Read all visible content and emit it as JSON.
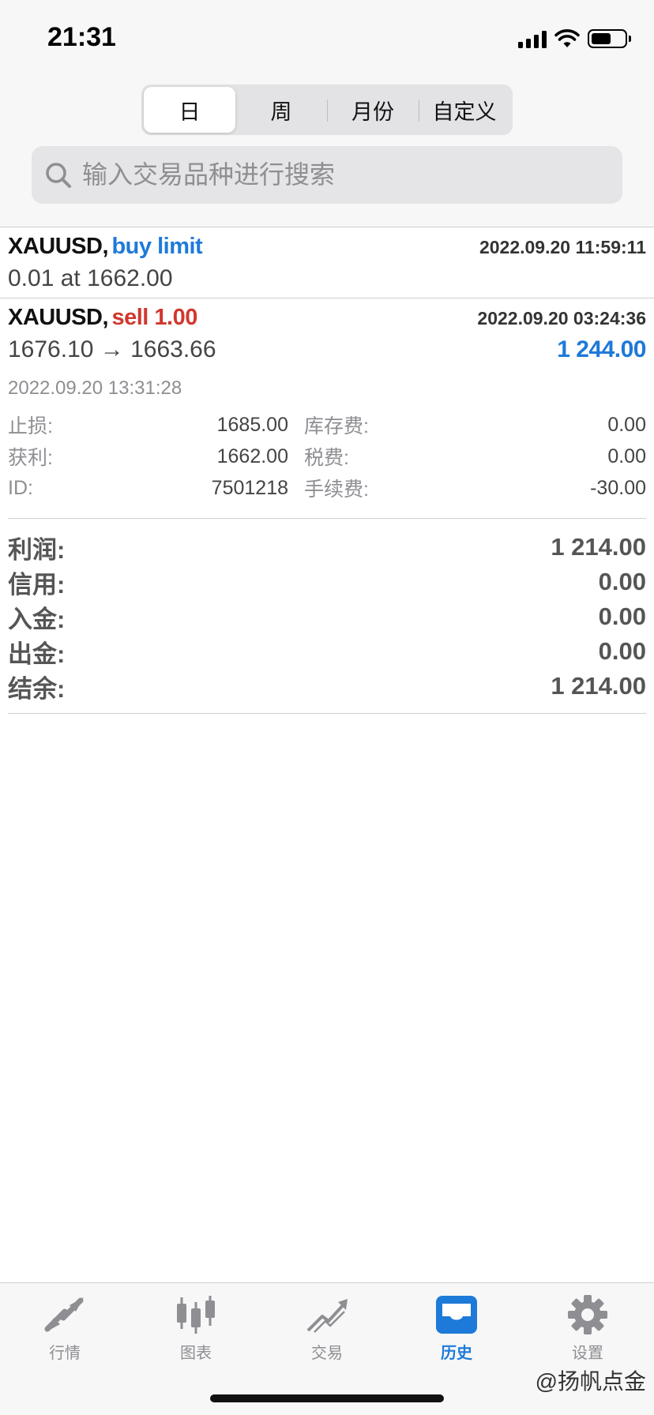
{
  "status": {
    "time": "21:31"
  },
  "segments": [
    {
      "label": "日",
      "active": true
    },
    {
      "label": "周"
    },
    {
      "label": "月份"
    },
    {
      "label": "自定义"
    }
  ],
  "search": {
    "placeholder": "输入交易品种进行搜索",
    "value": ""
  },
  "orders": [
    {
      "symbol": "XAUUSD,",
      "type": "buy limit",
      "type_color": "#1e7ad8",
      "time": "2022.09.20 11:59:11",
      "line2": "0.01 at 1662.00"
    },
    {
      "symbol": "XAUUSD,",
      "type": "sell 1.00",
      "type_color": "#d0382e",
      "time": "2022.09.20 03:24:36",
      "line2": "1676.10 → 1663.66",
      "profit": "1 244.00",
      "close_time": "2022.09.20 13:31:28",
      "details": [
        {
          "label": "止损:",
          "value": "1685.00"
        },
        {
          "label": "库存费:",
          "value": "0.00"
        },
        {
          "label": "获利:",
          "value": "1662.00"
        },
        {
          "label": "税费:",
          "value": "0.00"
        },
        {
          "label": "ID:",
          "value": "7501218"
        },
        {
          "label": "手续费:",
          "value": "-30.00"
        }
      ]
    }
  ],
  "summary": [
    {
      "label": "利润:",
      "value": "1 214.00"
    },
    {
      "label": "信用:",
      "value": "0.00"
    },
    {
      "label": "入金:",
      "value": "0.00"
    },
    {
      "label": "出金:",
      "value": "0.00"
    },
    {
      "label": "结余:",
      "value": "1 214.00"
    }
  ],
  "tabs": [
    {
      "label": "行情",
      "icon": "quotes-arrows-icon"
    },
    {
      "label": "图表",
      "icon": "candlestick-chart-icon"
    },
    {
      "label": "交易",
      "icon": "trade-trend-icon"
    },
    {
      "label": "历史",
      "icon": "history-tray-icon",
      "active": true
    },
    {
      "label": "设置",
      "icon": "gear-icon"
    }
  ],
  "watermark": "@扬帆点金",
  "colors": {
    "accent": "#1e7ad8",
    "sell": "#d0382e",
    "inactive": "#8e8e93"
  }
}
